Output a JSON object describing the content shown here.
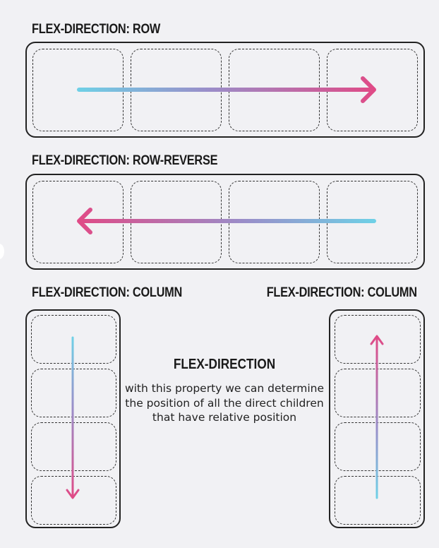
{
  "sections": {
    "row": {
      "label": "FLEX-DIRECTION: ROW"
    },
    "row_reverse": {
      "label": "FLEX-DIRECTION: ROW-REVERSE"
    },
    "column_left": {
      "label": "FLEX-DIRECTION: COLUMN"
    },
    "column_right": {
      "label": "FLEX-DIRECTION: COLUMN"
    }
  },
  "center": {
    "title": "FLEX-DIRECTION",
    "description": "with this property we can determine the position of all the direct children that have relative position"
  },
  "colors": {
    "arrow_start": "#6fd0e6",
    "arrow_mid": "#9b8cc8",
    "arrow_end": "#e04a86",
    "border": "#222222",
    "background": "#f1f1f4"
  },
  "icons": [
    "arrow-right-icon",
    "arrow-left-icon",
    "arrow-down-icon",
    "arrow-up-icon"
  ]
}
